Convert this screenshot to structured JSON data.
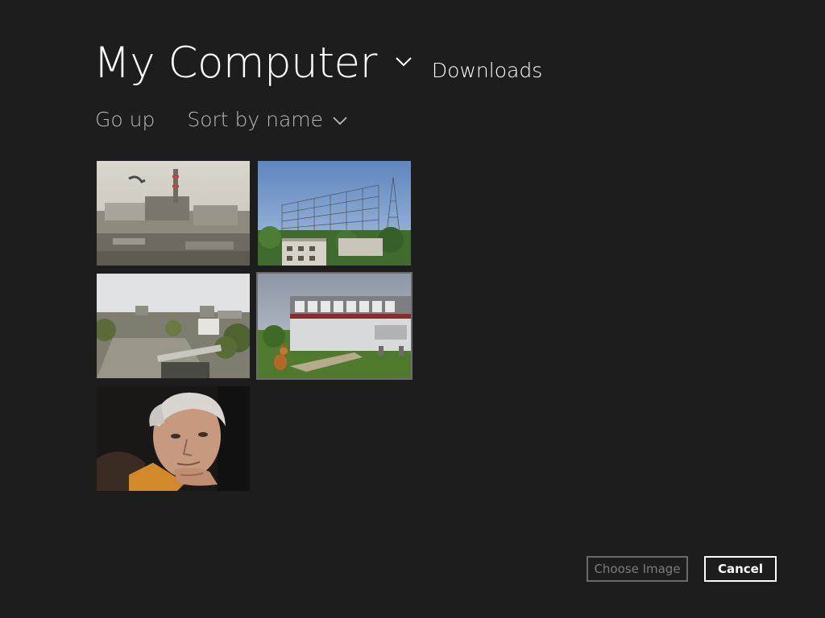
{
  "header": {
    "title": "My Computer",
    "subfolder": "Downloads",
    "title_dropdown_icon": "chevron-down-icon"
  },
  "toolbar": {
    "go_up": "Go up",
    "sort": "Sort by name",
    "sort_icon": "chevron-down-icon"
  },
  "images": [
    {
      "name": "reactor-aerial-photo"
    },
    {
      "name": "antenna-array-photo"
    },
    {
      "name": "city-aerial-photo"
    },
    {
      "name": "city-sign-fox-photo"
    },
    {
      "name": "man-portrait-photo"
    }
  ],
  "selected_image_index": 3,
  "buttons": {
    "choose": "Choose Image",
    "cancel": "Cancel"
  },
  "colors": {
    "background": "#1d1d1d",
    "text_primary": "#ffffff",
    "text_secondary": "#b9b9b9",
    "disabled": "#7c7c7c"
  }
}
